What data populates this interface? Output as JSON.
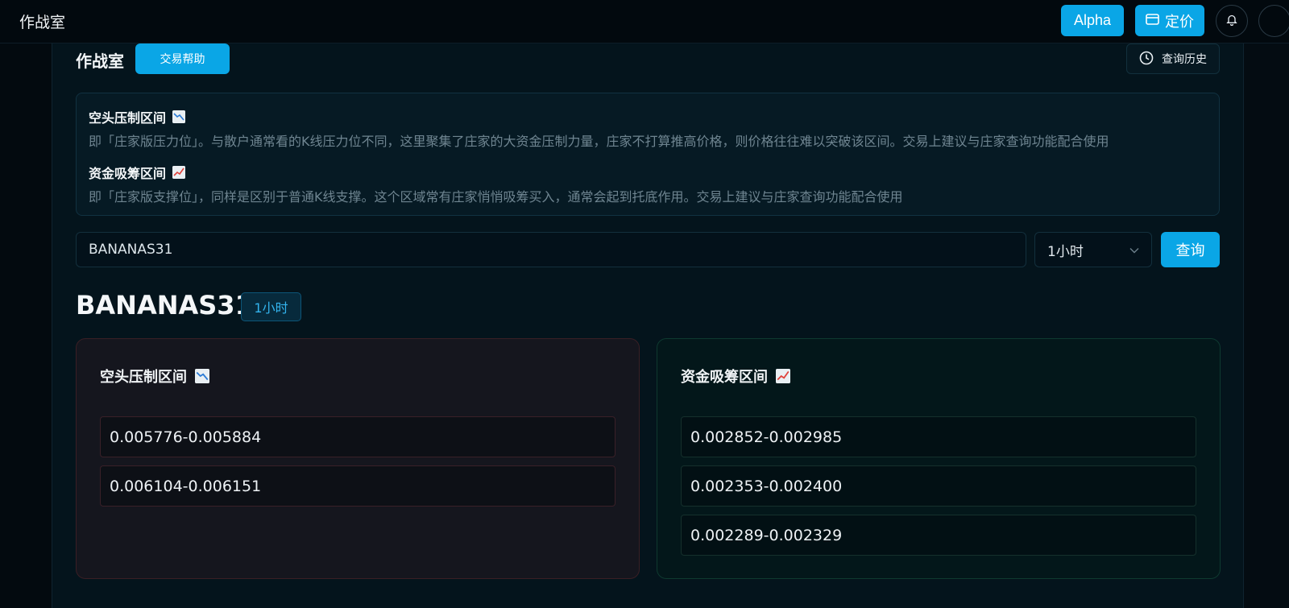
{
  "app": {
    "title": "作战室"
  },
  "topbar": {
    "alpha_label": "Alpha",
    "pricing_label": "定价"
  },
  "page": {
    "title": "作战室",
    "help_label": "交易帮助",
    "history_label": "查询历史"
  },
  "info": {
    "short_title": "空头压制区间",
    "short_desc": "即「庄家版压力位」。与散户通常看的K线压力位不同，这里聚集了庄家的大资金压制力量，庄家不打算推高价格，则价格往往难以突破该区间。交易上建议与庄家查询功能配合使用",
    "long_title": "资金吸筹区间",
    "long_desc": "即「庄家版支撑位」，同样是区别于普通K线支撑。这个区域常有庄家悄悄吸筹买入，通常会起到托底作用。交易上建议与庄家查询功能配合使用"
  },
  "search": {
    "value": "BANANAS31",
    "timeframe": "1小时",
    "query_label": "查询"
  },
  "result": {
    "symbol": "BANANAS31",
    "timeframe": "1小时",
    "short_card": {
      "title": "空头压制区间",
      "ranges": [
        "0.005776-0.005884",
        "0.006104-0.006151"
      ]
    },
    "long_card": {
      "title": "资金吸筹区间",
      "ranges": [
        "0.002852-0.002985",
        "0.002353-0.002400",
        "0.002289-0.002329"
      ]
    }
  },
  "colors": {
    "accent": "#0aa6e6",
    "short_border": "#3a1f25",
    "long_border": "#0e3a30"
  },
  "icons": {
    "pricing": "card-icon",
    "bell": "bell-icon",
    "history": "clock-icon",
    "short": "chart-decreasing-icon",
    "long": "chart-increasing-icon",
    "select": "chevron-down-icon"
  }
}
